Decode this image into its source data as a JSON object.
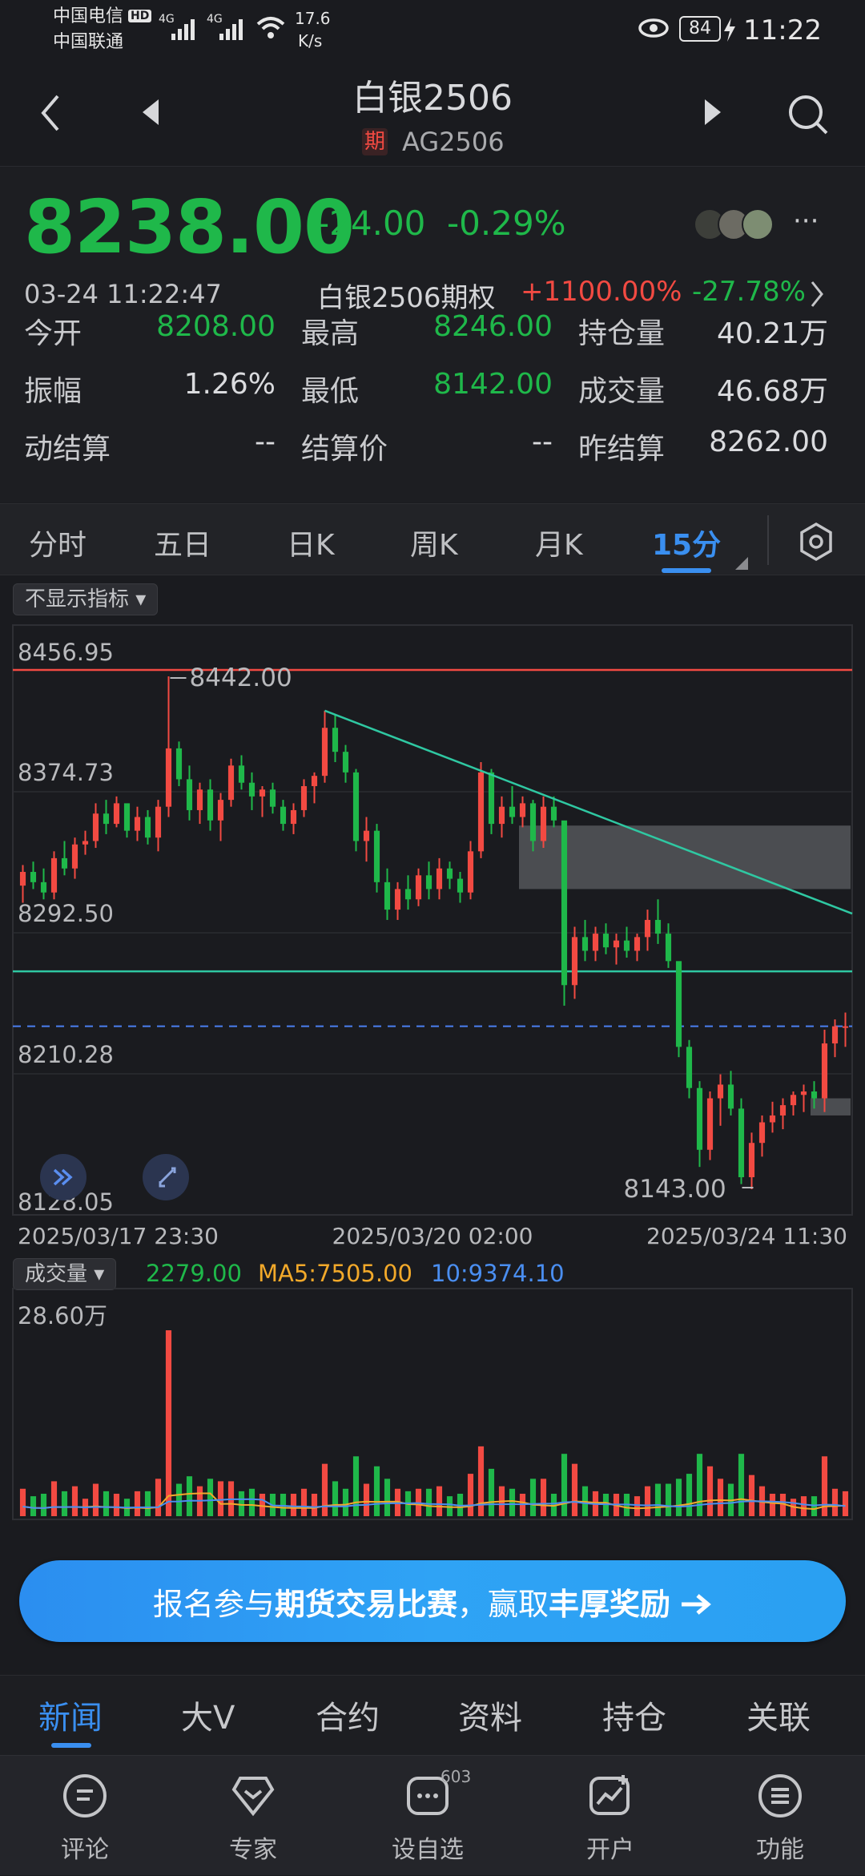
{
  "status": {
    "carrier1": "中国电信",
    "carrier2": "中国联通",
    "hd": "HD",
    "net1": "4G",
    "net2": "4G",
    "speed_value": "17.6",
    "speed_unit": "K/s",
    "battery": "84",
    "time": "11:22"
  },
  "nav": {
    "title": "白银2506",
    "badge": "期",
    "code": "AG2506"
  },
  "quote": {
    "price": "8238.00",
    "change": "-24.00",
    "change_pct": "-0.29%",
    "datetime": "03-24 11:22:47",
    "option_name": "白银2506期权",
    "option_up": "+1100.00%",
    "option_down": "-27.78%",
    "stats": [
      {
        "label": "今开",
        "value": "8208.00",
        "color": "green"
      },
      {
        "label": "最高",
        "value": "8246.00",
        "color": "green"
      },
      {
        "label": "持仓量",
        "value": "40.21万",
        "color": "white"
      },
      {
        "label": "振幅",
        "value": "1.26%",
        "color": "white"
      },
      {
        "label": "最低",
        "value": "8142.00",
        "color": "green"
      },
      {
        "label": "成交量",
        "value": "46.68万",
        "color": "white"
      },
      {
        "label": "动结算",
        "value": "--",
        "color": "white"
      },
      {
        "label": "结算价",
        "value": "--",
        "color": "white"
      },
      {
        "label": "昨结算",
        "value": "8262.00",
        "color": "white"
      }
    ]
  },
  "tabs": [
    "分时",
    "五日",
    "日K",
    "周K",
    "月K",
    "15分"
  ],
  "active_tab": "15分",
  "indicator_select": "不显示指标",
  "chart_data": {
    "type": "candlestick",
    "ylim": [
      8128.05,
      8456.95
    ],
    "y_ticks": [
      "8456.95",
      "8374.73",
      "8292.50",
      "8210.28",
      "8128.05"
    ],
    "x_ticks": [
      "2025/03/17 23:30",
      "2025/03/20 02:00",
      "2025/03/24 11:30"
    ],
    "high_label": "8442.00",
    "low_label": "8143.00",
    "candles": [
      [
        8320,
        8332,
        8310,
        8328
      ],
      [
        8328,
        8334,
        8318,
        8322
      ],
      [
        8322,
        8330,
        8312,
        8316
      ],
      [
        8316,
        8340,
        8312,
        8336
      ],
      [
        8336,
        8346,
        8326,
        8330
      ],
      [
        8330,
        8348,
        8324,
        8344
      ],
      [
        8344,
        8352,
        8338,
        8346
      ],
      [
        8346,
        8368,
        8342,
        8362
      ],
      [
        8362,
        8370,
        8350,
        8356
      ],
      [
        8356,
        8372,
        8354,
        8368
      ],
      [
        8368,
        8362,
        8348,
        8352
      ],
      [
        8352,
        8366,
        8346,
        8360
      ],
      [
        8360,
        8364,
        8344,
        8348
      ],
      [
        8348,
        8370,
        8340,
        8366
      ],
      [
        8366,
        8442,
        8360,
        8400
      ],
      [
        8400,
        8404,
        8378,
        8382
      ],
      [
        8382,
        8390,
        8358,
        8364
      ],
      [
        8364,
        8380,
        8356,
        8376
      ],
      [
        8376,
        8382,
        8352,
        8358
      ],
      [
        8358,
        8374,
        8346,
        8370
      ],
      [
        8370,
        8394,
        8366,
        8390
      ],
      [
        8390,
        8396,
        8376,
        8380
      ],
      [
        8380,
        8386,
        8364,
        8372
      ],
      [
        8372,
        8378,
        8360,
        8376
      ],
      [
        8376,
        8380,
        8362,
        8366
      ],
      [
        8366,
        8370,
        8352,
        8356
      ],
      [
        8356,
        8368,
        8350,
        8364
      ],
      [
        8364,
        8382,
        8360,
        8378
      ],
      [
        8378,
        8386,
        8368,
        8384
      ],
      [
        8384,
        8422,
        8380,
        8412
      ],
      [
        8412,
        8420,
        8392,
        8398
      ],
      [
        8398,
        8402,
        8380,
        8386
      ],
      [
        8386,
        8388,
        8340,
        8346
      ],
      [
        8346,
        8360,
        8334,
        8352
      ],
      [
        8352,
        8356,
        8316,
        8322
      ],
      [
        8322,
        8330,
        8300,
        8306
      ],
      [
        8306,
        8322,
        8300,
        8318
      ],
      [
        8318,
        8326,
        8306,
        8312
      ],
      [
        8312,
        8330,
        8308,
        8326
      ],
      [
        8326,
        8334,
        8312,
        8318
      ],
      [
        8318,
        8336,
        8312,
        8330
      ],
      [
        8330,
        8334,
        8318,
        8324
      ],
      [
        8324,
        8328,
        8310,
        8316
      ],
      [
        8316,
        8346,
        8312,
        8340
      ],
      [
        8340,
        8392,
        8336,
        8386
      ],
      [
        8386,
        8388,
        8350,
        8356
      ],
      [
        8356,
        8372,
        8348,
        8366
      ],
      [
        8366,
        8378,
        8356,
        8360
      ],
      [
        8360,
        8372,
        8354,
        8368
      ],
      [
        8368,
        8370,
        8340,
        8346
      ],
      [
        8346,
        8372,
        8342,
        8366
      ],
      [
        8366,
        8372,
        8354,
        8358
      ],
      [
        8358,
        8300,
        8250,
        8262
      ],
      [
        8262,
        8296,
        8254,
        8290
      ],
      [
        8290,
        8300,
        8276,
        8282
      ],
      [
        8282,
        8296,
        8276,
        8292
      ],
      [
        8292,
        8298,
        8280,
        8284
      ],
      [
        8284,
        8292,
        8274,
        8288
      ],
      [
        8288,
        8296,
        8278,
        8282
      ],
      [
        8282,
        8292,
        8276,
        8290
      ],
      [
        8290,
        8306,
        8282,
        8300
      ],
      [
        8300,
        8312,
        8286,
        8292
      ],
      [
        8292,
        8298,
        8272,
        8276
      ],
      [
        8276,
        8250,
        8220,
        8226
      ],
      [
        8226,
        8230,
        8196,
        8202
      ],
      [
        8202,
        8206,
        8156,
        8166
      ],
      [
        8166,
        8200,
        8160,
        8196
      ],
      [
        8196,
        8210,
        8180,
        8204
      ],
      [
        8204,
        8212,
        8186,
        8190
      ],
      [
        8190,
        8196,
        8146,
        8150
      ],
      [
        8150,
        8176,
        8143,
        8170
      ],
      [
        8170,
        8186,
        8162,
        8182
      ],
      [
        8182,
        8194,
        8176,
        8186
      ],
      [
        8186,
        8196,
        8178,
        8192
      ],
      [
        8192,
        8200,
        8186,
        8198
      ],
      [
        8198,
        8204,
        8188,
        8200
      ],
      [
        8200,
        8206,
        8190,
        8196
      ],
      [
        8196,
        8236,
        8188,
        8228
      ],
      [
        8228,
        8242,
        8220,
        8238
      ],
      [
        8238,
        8246,
        8226,
        8238
      ]
    ],
    "volume": {
      "label": "成交量",
      "value": "2279.00",
      "ma5_label": "MA5:7505.00",
      "ma10_label": "10:9374.10",
      "max_label": "28.60万"
    }
  },
  "banner": {
    "text_a": "报名参与",
    "text_b": "期货交易比赛",
    "text_c": "，赢取",
    "text_d": "丰厚奖励"
  },
  "bottom_tabs": [
    "新闻",
    "大V",
    "合约",
    "资料",
    "持仓",
    "关联"
  ],
  "active_bottom_tab": "新闻",
  "bottom_bar": [
    {
      "label": "评论",
      "icon": "comment-icon"
    },
    {
      "label": "专家",
      "icon": "expert-icon"
    },
    {
      "label": "设自选",
      "icon": "watchlist-icon",
      "badge": "603"
    },
    {
      "label": "开户",
      "icon": "open-account-icon"
    },
    {
      "label": "功能",
      "icon": "menu-icon"
    }
  ],
  "colors": {
    "up": "#f24a42",
    "down": "#1fb84a",
    "accent": "#3a8ff0",
    "trend": "#2fc8a2"
  }
}
